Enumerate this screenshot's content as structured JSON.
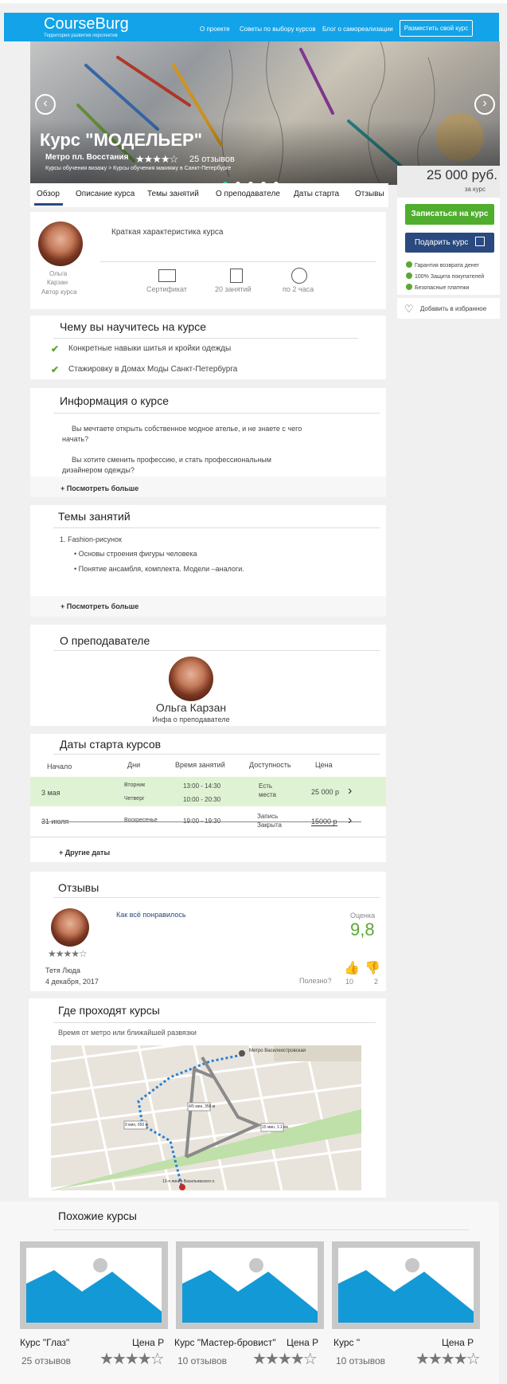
{
  "header": {
    "logo": "CourseBurg",
    "tagline": "Территория развития перспектив",
    "nav": [
      "О проекте",
      "Советы по выбору курсов",
      "Блог о самореализации"
    ],
    "cta": "Разместить свой курс"
  },
  "hero": {
    "title": "Курс \"МОДЕЛЬЕР\"",
    "metro": "Метро  пл.  Восстания",
    "rating_stars": "★★★★☆",
    "reviews": "25 отзывов",
    "breadcrumbs": "Курсы обучения визажу > Курсы обучения макияжу в Санкт-Петербурге",
    "prev_icon": "chevron-left-icon",
    "next_icon": "chevron-right-icon"
  },
  "price": {
    "value": "25 000 руб.",
    "sub": "за курс",
    "enroll": "Записаться на курс",
    "gift": "Подарить курс",
    "guarantees": [
      "Гарантия возврата денег",
      "100% Защита покупателей",
      "Безопасные платежи"
    ],
    "favorite": "Добавить в избранное"
  },
  "tabs": [
    "Обзор",
    "Описание курса",
    "Темы занятий",
    "О преподавателе",
    "Даты старта",
    "Отзывы"
  ],
  "author": {
    "first": "Ольга",
    "last": "Карзан",
    "role": "Автор курса",
    "summary_title": "Краткая характеристика курса",
    "features": [
      "Сертификат",
      "20 занятий",
      "по 2 часа"
    ]
  },
  "learn": {
    "title": "Чему вы научитесь на курсе",
    "items": [
      "Конкретные навыки шитья и кройки одежды",
      "Стажировку в Домах Моды Санкт-Петербурга"
    ]
  },
  "info": {
    "title": "Информация о курсе",
    "p1a": "Вы мечтаете открыть собственное модное ателье, и не знаете с чего",
    "p1b": "начать?",
    "p2a": "Вы хотите сменить профессию, и стать профессиональным",
    "p2b": "дизайнером одежды?",
    "more": "+ Посмотреть больше"
  },
  "topics": {
    "title": "Темы занятий",
    "item1": "1. Fashion-рисунок",
    "sub1": "• Основы строения фигуры человека",
    "sub2": "• Понятие ансамбля, комплекта. Модели –аналоги.",
    "more": "+ Посмотреть больше"
  },
  "teacher": {
    "title": "О преподавателе",
    "name": "Ольга Карзан",
    "info": "Инфа о преподавателе"
  },
  "dates": {
    "title": "Даты старта курсов",
    "headers": [
      "Начало",
      "Дни",
      "Время занятий",
      "Доступность",
      "Цена"
    ],
    "row1": {
      "start": "3 мая",
      "day1": "Вторник",
      "day2": "Четверг",
      "t1": "13:00 - 14:30",
      "t2": "10:00 - 20:30",
      "a1": "Есть",
      "a2": "места",
      "price": "25 000 р"
    },
    "row2": {
      "start": "31 июля",
      "day1": "Воскресенье",
      "t1": "19:00 - 19:30",
      "a1": "Запись",
      "a2": "Закрыта",
      "price": "15000 р"
    },
    "more": "+ Другие даты"
  },
  "reviews": {
    "title": "Отзывы",
    "text": "Как всё понравилось",
    "score_label": "Оценка",
    "score": "9,8",
    "stars": "★★★★☆",
    "author": "Тетя Люда",
    "date": "4 декабря, 2017",
    "useful": "Полезно?",
    "likes": "10",
    "dislikes": "2"
  },
  "location": {
    "title": "Где проходят курсы",
    "sub": "Время от метро или ближайшей развязки",
    "map_labels": {
      "metro": "Метро Василеостровская",
      "walk1": "9 мин, 650 м",
      "walk2": "4/5 мин, 350 м",
      "walk3": "15 мин, 1.1 км",
      "dest": "13-я линия Васильевского о."
    }
  },
  "similar": {
    "title": "Похожие курсы",
    "items": [
      {
        "name": "Курс \"Глаз\"",
        "price": "Цена Р",
        "reviews": "25 отзывов",
        "stars": "★★★★☆"
      },
      {
        "name": "Курс \"Мастер-бровист\"",
        "price": "Цена Р",
        "reviews": "10 отзывов",
        "stars": "★★★★☆"
      },
      {
        "name": "Курс \"",
        "price": "Цена Р",
        "reviews": "10 отзывов",
        "stars": "★★★★☆"
      }
    ]
  },
  "colors": {
    "brand": "#12a3e8",
    "green": "#4fae2d",
    "navy": "#29497f",
    "highlight": "#dff3d4"
  }
}
